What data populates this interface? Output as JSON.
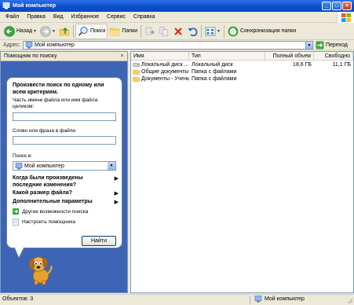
{
  "window": {
    "title": "Мой компьютер",
    "accent": "#0A4FD0"
  },
  "menu": [
    "Файл",
    "Правка",
    "Вид",
    "Избранное",
    "Сервис",
    "Справка"
  ],
  "toolbar": {
    "back": "Назад",
    "search": "Поиск",
    "folders": "Папки",
    "sync": "Синхронизация папки"
  },
  "address": {
    "label": "Адрес:",
    "value": "Мой компьютер",
    "go": "Переход"
  },
  "search_pane": {
    "title": "Помощник по поиску",
    "heading": "Произвести поиск по одному или всем критериям.",
    "filename_label": "Часть имени файла или имя файла целиком:",
    "filename_value": "",
    "phrase_label": "Слово или фраза в файле:",
    "phrase_value": "",
    "lookin_label": "Поиск в:",
    "lookin_value": "Мой компьютер",
    "option_modified": "Когда были произведены последние изменения?",
    "option_size": "Какой размер файла?",
    "option_advanced": "Дополнительные параметры",
    "link_other": "Другие возможности поиска",
    "link_setup": "Настроить помощника",
    "find_button": "Найти"
  },
  "columns": [
    "Имя",
    "Тип",
    "Полный объем",
    "Свободно"
  ],
  "files": [
    {
      "icon": "local-disk-icon",
      "name": "Локальный диск ...",
      "type": "Локальный диск",
      "total": "18,6 ГБ",
      "free": "11,1 ГБ"
    },
    {
      "icon": "folder-icon",
      "name": "Общие документы",
      "type": "Папка с файлами",
      "total": "",
      "free": ""
    },
    {
      "icon": "folder-icon",
      "name": "Документы - Учень",
      "type": "Папка с файлами",
      "total": "",
      "free": ""
    }
  ],
  "status": {
    "objects": "Объектов: 3",
    "location": "Мой компьютер"
  }
}
